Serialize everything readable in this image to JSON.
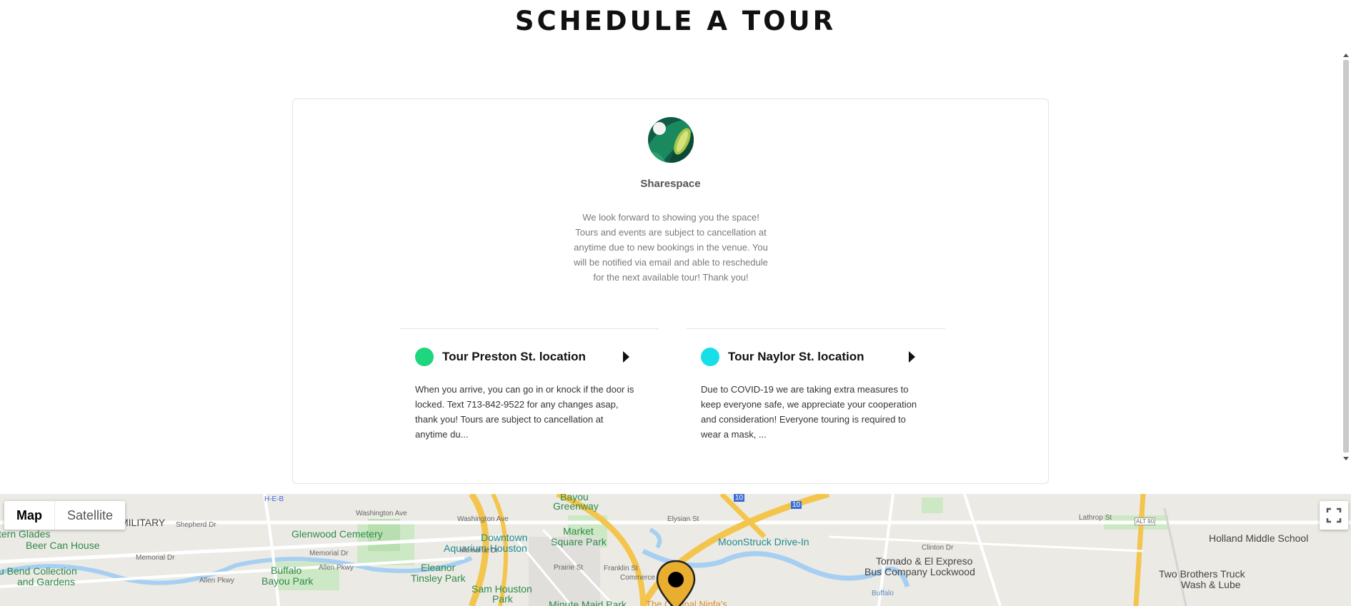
{
  "page": {
    "title": "SCHEDULE A TOUR"
  },
  "business": {
    "name": "Sharespace",
    "description": "We look forward to showing you the space! Tours and events are subject to cancellation at anytime due to new bookings in the venue. You will be notified via email and able to reschedule for the next available tour! Thank you!"
  },
  "tours": [
    {
      "name": "Tour Preston St. location",
      "color": "#1dd67e",
      "description": "When you arrive, you can go in or knock if the door is locked. Text 713-842-9522 for any changes asap, thank you! Tours are subject to cancellation at anytime du..."
    },
    {
      "name": "Tour Naylor St. location",
      "color": "#17dfe8",
      "description": "Due to COVID-19 we are taking extra measures to keep everyone safe, we appreciate your cooperation and consideration! Everyone touring is required to wear a mask, ..."
    }
  ],
  "map": {
    "map_label": "Map",
    "satellite_label": "Satellite",
    "labels": {
      "heb": "H-E-B",
      "military": "MILITARY",
      "glades": "tern Glades",
      "beer_can": "Beer Can House",
      "bend": "u Bend Collection",
      "gardens": "and Gardens",
      "glenwood": "Glenwood Cemetery",
      "buffalo_bayou_park_1": "Buffalo",
      "buffalo_bayou_park_2": "Bayou Park",
      "eleanor_1": "Eleanor",
      "eleanor_2": "Tinsley Park",
      "downtown_1": "Downtown",
      "downtown_2": "Aquarium-Houston",
      "market_1": "Market",
      "market_2": "Square Park",
      "bayou_1": "Bayou",
      "bayou_2": "Greenway",
      "sam_houston_1": "Sam Houston",
      "sam_houston_2": "Park",
      "moonstruck": "MoonStruck Drive-In",
      "tornado_1": "Tornado & El Expreso",
      "tornado_2": "Bus Company Lockwood",
      "holland": "Holland Middle School",
      "two_brothers_1": "Two Brothers Truck",
      "two_brothers_2": "Wash & Lube",
      "washington_ave_1": "Washington Ave",
      "washington_ave_2": "Washington Ave",
      "memorial_dr_1": "Memorial Dr",
      "memorial_dr_2": "Memorial Dr",
      "memorial_dr_3": "Memorial Dr",
      "allen_pkwy_1": "Allen Pkwy",
      "allen_pkwy_2": "Allen Pkwy",
      "shepherd_dr": "Shepherd Dr",
      "prairie_st": "Prairie St",
      "franklin_st": "Franklin St",
      "commerce_st": "Commerce St",
      "elysian_st": "Elysian St",
      "clinton_dr": "Clinton Dr",
      "lathrop_st": "Lathrop St",
      "buffalo": "Buffalo",
      "i10_a": "10",
      "i10_b": "10",
      "alt90": "ALT 90",
      "nopal": "The Original Ninfa's",
      "minute": "Minute Maid Park"
    }
  }
}
